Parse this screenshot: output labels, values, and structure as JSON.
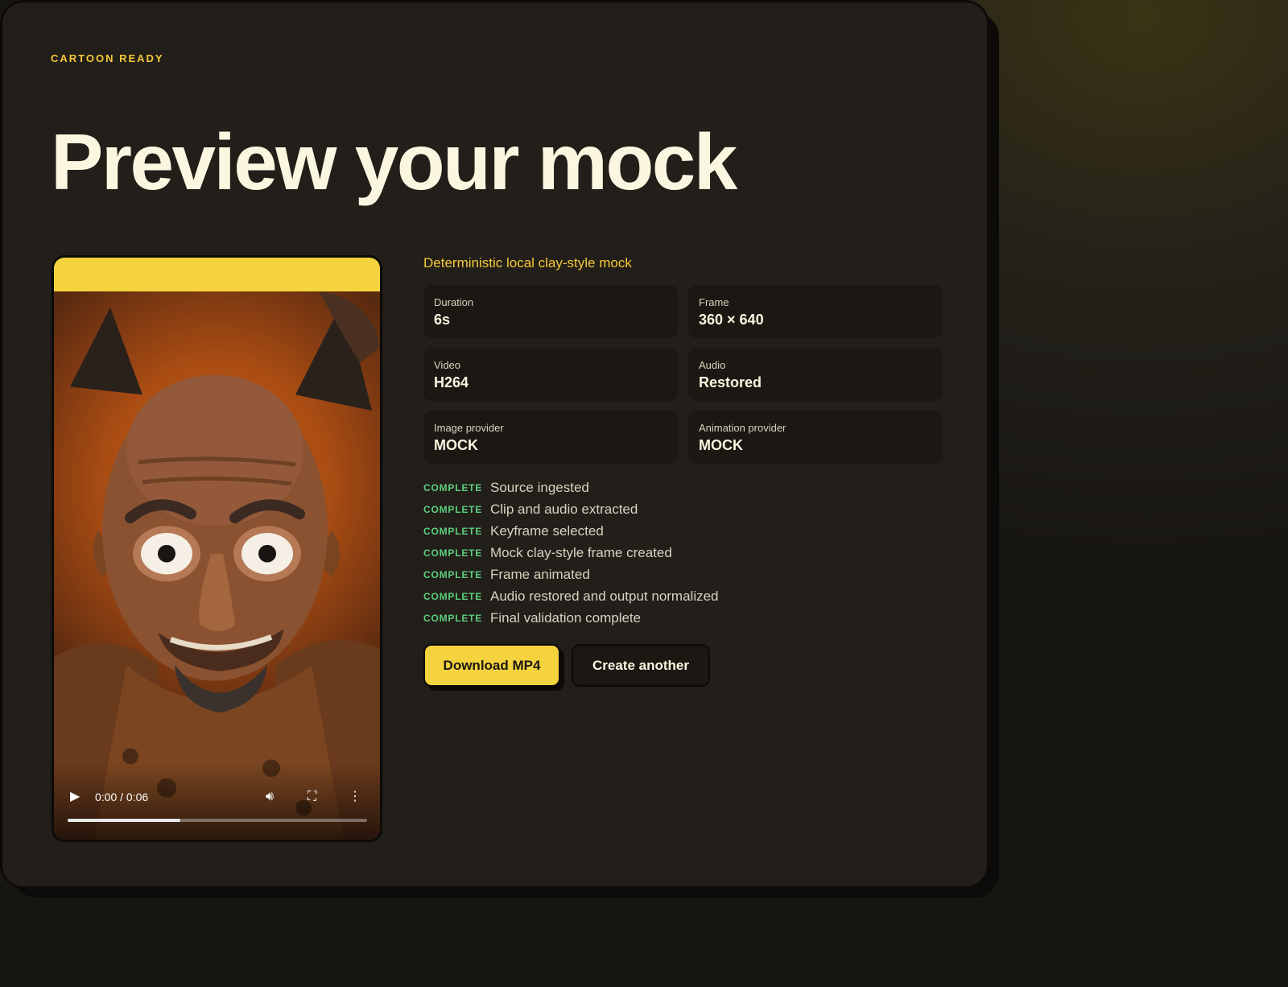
{
  "header": {
    "eyebrow": "CARTOON READY",
    "title": "Preview your mock"
  },
  "video": {
    "time_display": "0:00 / 0:06",
    "progress": 0.375,
    "icons": [
      "play-icon",
      "volume-icon",
      "fullscreen-icon",
      "more-options-icon"
    ]
  },
  "details": {
    "subtitle": "Deterministic local clay-style mock",
    "stats": [
      {
        "label": "Duration",
        "value": "6s"
      },
      {
        "label": "Frame",
        "value": "360 × 640"
      },
      {
        "label": "Video",
        "value": "H264"
      },
      {
        "label": "Audio",
        "value": "Restored"
      },
      {
        "label": "Image provider",
        "value": "MOCK"
      },
      {
        "label": "Animation provider",
        "value": "MOCK"
      }
    ],
    "steps": [
      {
        "status": "COMPLETE",
        "text": "Source ingested"
      },
      {
        "status": "COMPLETE",
        "text": "Clip and audio extracted"
      },
      {
        "status": "COMPLETE",
        "text": "Keyframe selected"
      },
      {
        "status": "COMPLETE",
        "text": "Mock clay-style frame created"
      },
      {
        "status": "COMPLETE",
        "text": "Frame animated"
      },
      {
        "status": "COMPLETE",
        "text": "Audio restored and output normalized"
      },
      {
        "status": "COMPLETE",
        "text": "Final validation complete"
      }
    ]
  },
  "actions": {
    "download_label": "Download MP4",
    "create_label": "Create another"
  },
  "colors": {
    "accent": "#f5d33e",
    "complete": "#5ccf7e",
    "card": "#221e19"
  }
}
